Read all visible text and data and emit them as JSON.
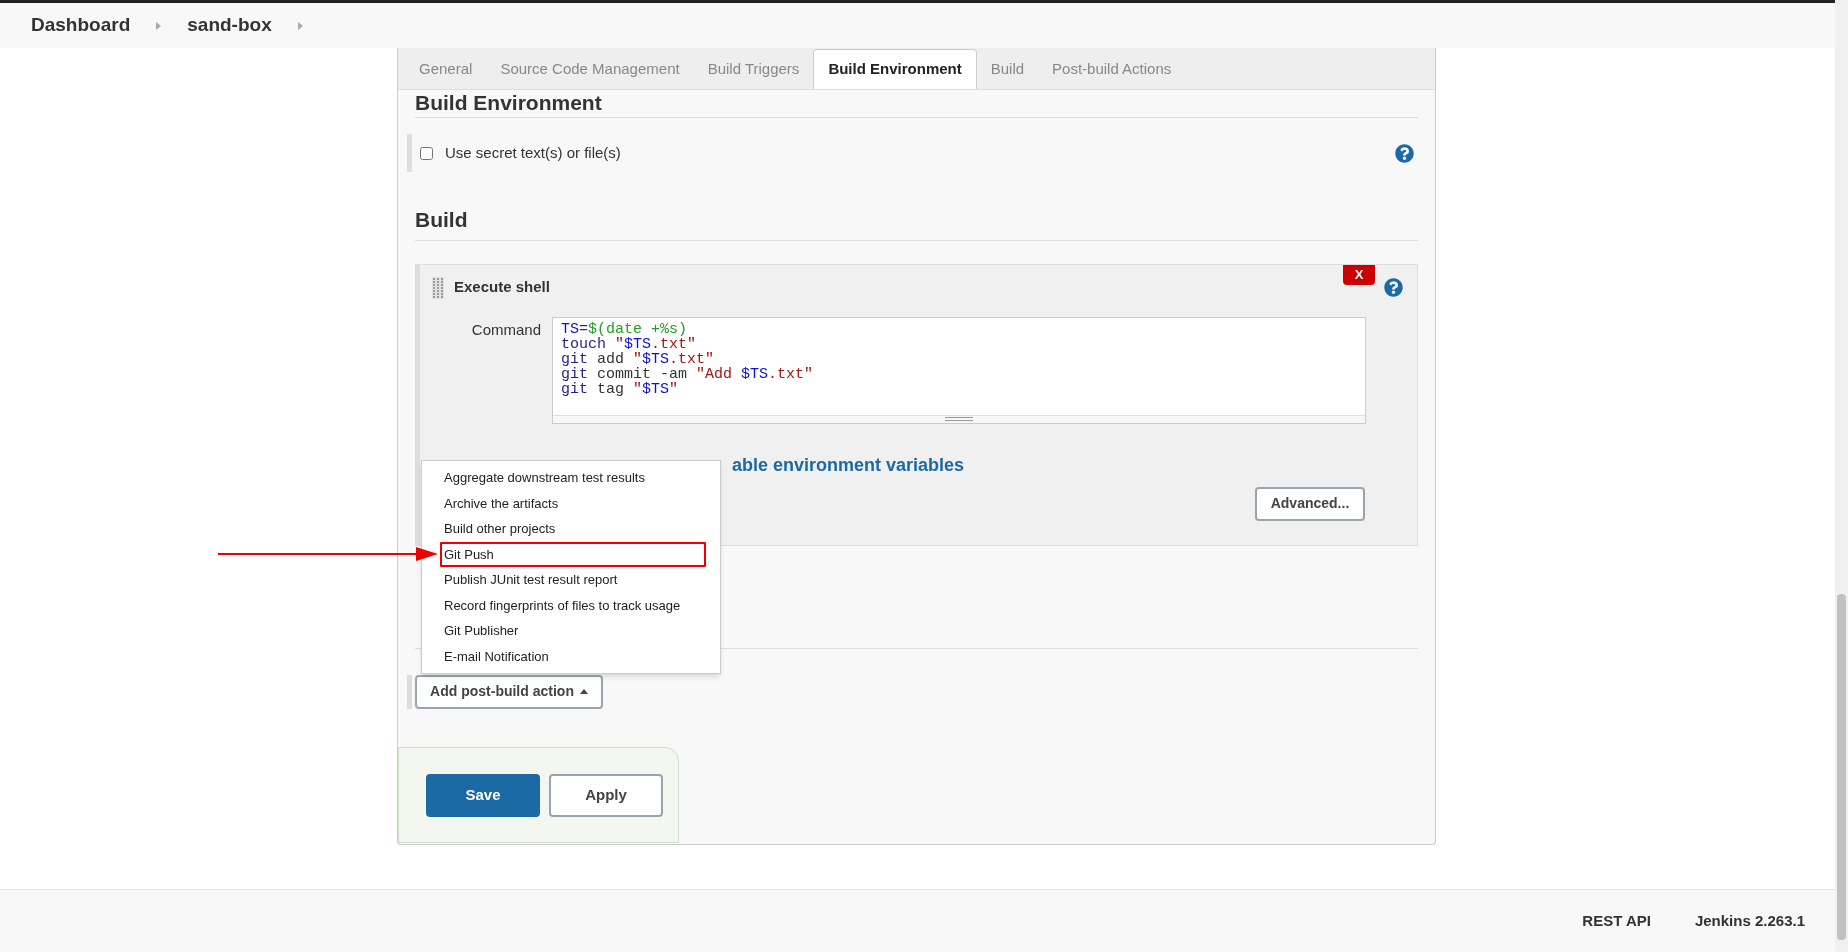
{
  "breadcrumbs": [
    {
      "label": "Dashboard"
    },
    {
      "label": "sand-box"
    }
  ],
  "tabs": [
    {
      "label": "General",
      "selected": false
    },
    {
      "label": "Source Code Management",
      "selected": false
    },
    {
      "label": "Build Triggers",
      "selected": false
    },
    {
      "label": "Build Environment",
      "selected": true
    },
    {
      "label": "Build",
      "selected": false
    },
    {
      "label": "Post-build Actions",
      "selected": false
    }
  ],
  "build_environment": {
    "heading": "Build Environment",
    "options": [
      {
        "label": "Use secret text(s) or file(s)",
        "checked": false
      }
    ]
  },
  "build": {
    "heading": "Build",
    "step": {
      "title": "Execute shell",
      "delete_label": "X",
      "command_label": "Command",
      "command_lines": [
        [
          {
            "text": "TS",
            "kind": "variable"
          },
          {
            "text": "=",
            "kind": "plain"
          },
          {
            "text": "$(date +%s)",
            "kind": "subshell"
          }
        ],
        [
          {
            "text": "touch",
            "kind": "command"
          },
          {
            "text": " \"",
            "kind": "string"
          },
          {
            "text": "$TS",
            "kind": "variable"
          },
          {
            "text": ".txt\"",
            "kind": "string"
          }
        ],
        [
          {
            "text": "git",
            "kind": "command"
          },
          {
            "text": " add ",
            "kind": "plain"
          },
          {
            "text": "\"",
            "kind": "string"
          },
          {
            "text": "$TS",
            "kind": "variable"
          },
          {
            "text": ".txt\"",
            "kind": "string"
          }
        ],
        [
          {
            "text": "git",
            "kind": "command"
          },
          {
            "text": " commit -am ",
            "kind": "plain"
          },
          {
            "text": "\"Add ",
            "kind": "string"
          },
          {
            "text": "$TS",
            "kind": "variable"
          },
          {
            "text": ".txt\"",
            "kind": "string"
          }
        ],
        [
          {
            "text": "git",
            "kind": "command"
          },
          {
            "text": " tag ",
            "kind": "plain"
          },
          {
            "text": "\"",
            "kind": "string"
          },
          {
            "text": "$TS",
            "kind": "variable"
          },
          {
            "text": "\"",
            "kind": "string"
          }
        ]
      ],
      "env_link": "able environment variables",
      "advanced_button": "Advanced..."
    }
  },
  "post_build": {
    "add_button": "Add post-build action",
    "menu_open": true,
    "menu_items": [
      {
        "label": "Aggregate downstream test results",
        "highlighted": false
      },
      {
        "label": "Archive the artifacts",
        "highlighted": false
      },
      {
        "label": "Build other projects",
        "highlighted": false
      },
      {
        "label": "Git Push",
        "highlighted": true
      },
      {
        "label": "Publish JUnit test result report",
        "highlighted": false
      },
      {
        "label": "Record fingerprints of files to track usage",
        "highlighted": false
      },
      {
        "label": "Git Publisher",
        "highlighted": false
      },
      {
        "label": "E-mail Notification",
        "highlighted": false
      }
    ]
  },
  "actions": {
    "save": "Save",
    "apply": "Apply"
  },
  "footer": {
    "links": [
      "REST API",
      "Jenkins 2.263.1"
    ]
  }
}
